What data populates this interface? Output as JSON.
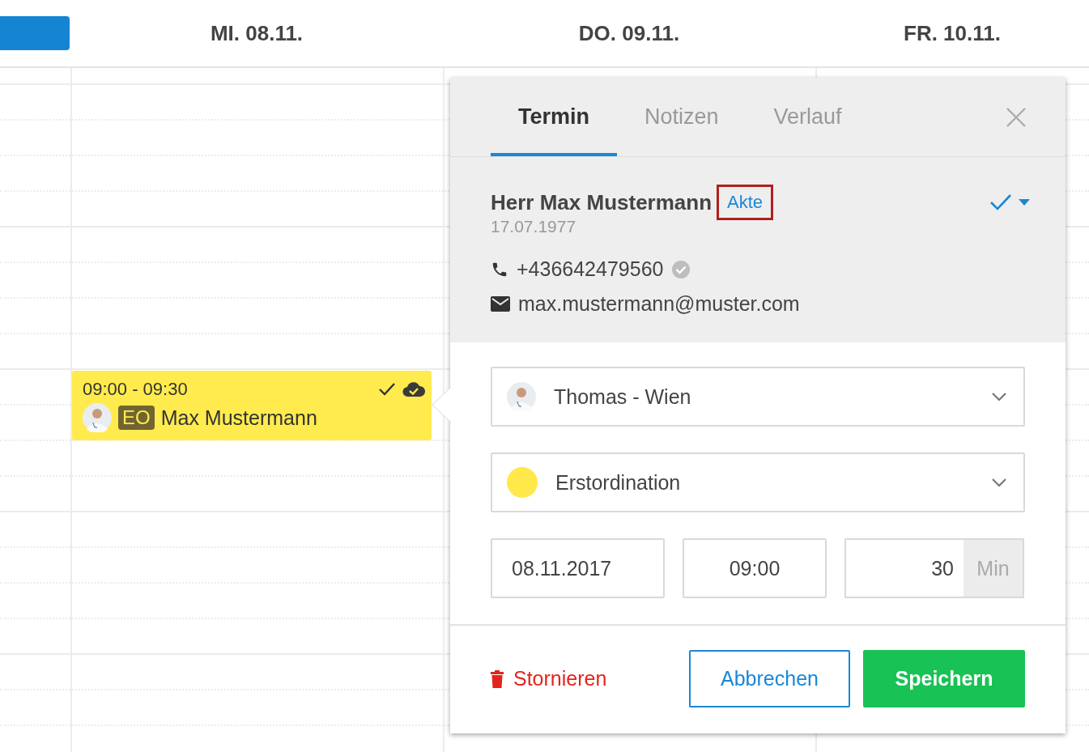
{
  "day_headers": [
    {
      "label": "MI. 08.11."
    },
    {
      "label": "DO. 09.11."
    },
    {
      "label": "FR. 10.11."
    }
  ],
  "appointment": {
    "time": "09:00 - 09:30",
    "tag": "EO",
    "patient": "Max Mustermann",
    "confirmed": true,
    "synced": true,
    "color": "#ffeb4d"
  },
  "popover": {
    "tabs": [
      {
        "label": "Termin",
        "selected": true
      },
      {
        "label": "Notizen",
        "selected": false
      },
      {
        "label": "Verlauf",
        "selected": false
      }
    ],
    "patient": {
      "name": "Herr Max Mustermann",
      "record_link": {
        "label": "Akte",
        "highlighted": true
      },
      "birthdate": "17.07.1977",
      "confirmed": true,
      "phone": "+436642479560",
      "phone_verified": true,
      "email": "max.mustermann@muster.com"
    },
    "fields": {
      "resource": "Thomas - Wien",
      "appointment_type": {
        "label": "Erstordination",
        "color": "#ffe94a"
      },
      "date": "08.11.2017",
      "time": "09:00",
      "duration": "30",
      "duration_unit": "Min"
    },
    "actions": {
      "cancel": "Stornieren",
      "abort": "Abbrechen",
      "save": "Speichern"
    }
  }
}
